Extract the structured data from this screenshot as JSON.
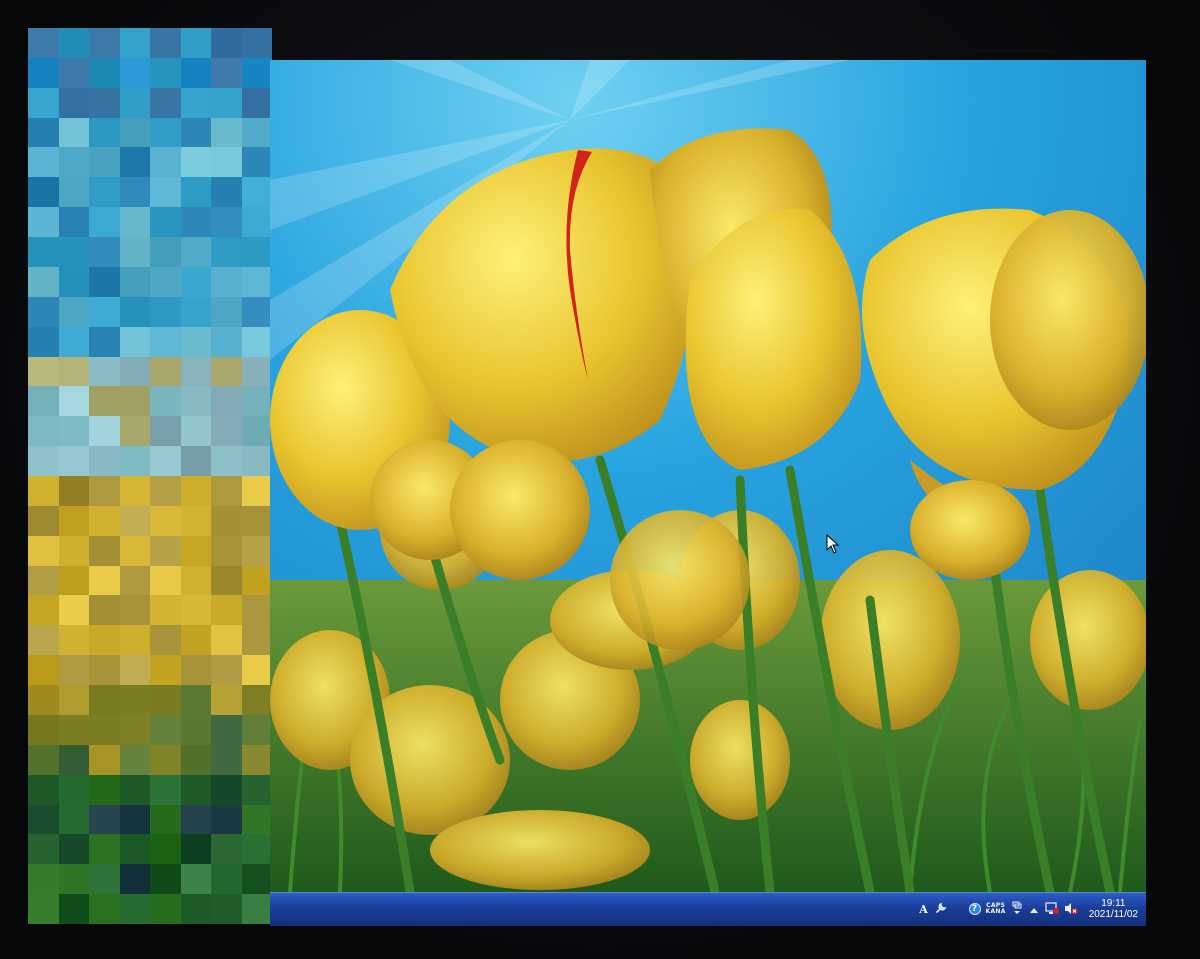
{
  "taskbar": {
    "tray": {
      "ime_mode": "A",
      "caps_label": "CAPS",
      "kana_label": "KANA",
      "icons": [
        "ime-mode-icon",
        "tools-icon",
        "network-globe-icon",
        "help-icon",
        "caps-kana-indicator",
        "expand-arrow-icon",
        "monitor-alert-icon",
        "speaker-muted-icon"
      ]
    },
    "clock": {
      "time": "19:11",
      "date": "2021/11/02"
    }
  },
  "colors": {
    "sky": "#2aa9e0",
    "tulip_yellow": "#e8c93a",
    "stem_green": "#3c7f2a",
    "taskbar_blue": "#1b3f9b"
  }
}
